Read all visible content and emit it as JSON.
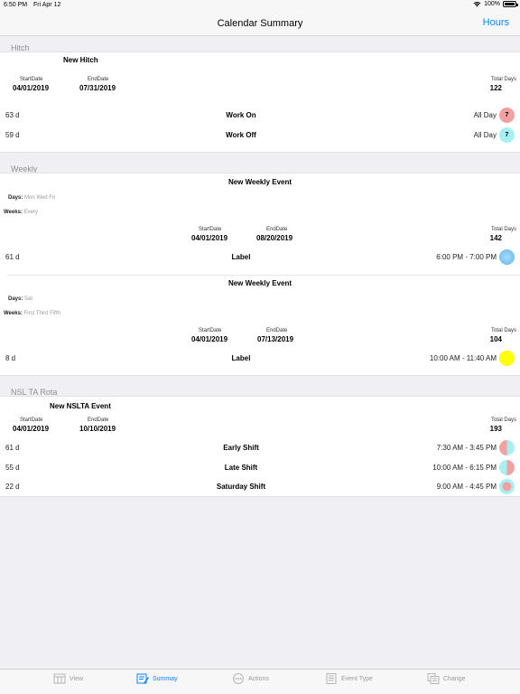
{
  "status": {
    "time": "6:50 PM",
    "date": "Fri Apr 12",
    "battery": "100%"
  },
  "navbar": {
    "title": "Calendar Summary",
    "right_button": "Hours"
  },
  "sections": {
    "hitch": {
      "header": "Hitch",
      "event": {
        "name": "New Hitch",
        "start_label": "StartDate",
        "start": "04/01/2019",
        "end_label": "EndDate",
        "end": "07/31/2019",
        "total_label": "Total Days",
        "total": "122",
        "rows": [
          {
            "count": "63 d",
            "label": "Work On",
            "time": "All Day",
            "badge": "7",
            "color": "#f4a0a0"
          },
          {
            "count": "59 d",
            "label": "Work Off",
            "time": "All Day",
            "badge": "7",
            "color": "#a6f0f2"
          }
        ]
      }
    },
    "weekly": {
      "header": "Weekly",
      "events": [
        {
          "name": "New Weekly Event",
          "days_label": "Days:",
          "days": "Mon Wed Fri",
          "weeks_label": "Weeks:",
          "weeks": "Every",
          "start_label": "StartDate",
          "start": "04/01/2019",
          "end_label": "EndDate",
          "end": "08/20/2019",
          "total_label": "Total Days",
          "total": "142",
          "row": {
            "count": "61 d",
            "label": "Label",
            "time": "6:00 PM - 7:00 PM",
            "color": "#7ec4f2"
          }
        },
        {
          "name": "New Weekly Event",
          "days_label": "Days:",
          "days": "Sat",
          "weeks_label": "Weeks:",
          "weeks": "First Third Fifth",
          "start_label": "StartDate",
          "start": "04/01/2019",
          "end_label": "EndDate",
          "end": "07/13/2019",
          "total_label": "Total Days",
          "total": "104",
          "row": {
            "count": "8 d",
            "label": "Label",
            "time": "10:00 AM - 11:40 AM",
            "color": "#ffff00"
          }
        }
      ]
    },
    "nsl": {
      "header": "NSL TA Rota",
      "event": {
        "name": "New NSLTA Event",
        "start_label": "StartDate",
        "start": "04/01/2019",
        "end_label": "EndDate",
        "end": "10/10/2019",
        "total_label": "Total Days",
        "total": "193",
        "rows": [
          {
            "count": "61 d",
            "label": "Early Shift",
            "time": "7:30 AM - 3:45 PM",
            "color_a": "#f4a0a0",
            "color_b": "#a6f0f2"
          },
          {
            "count": "55 d",
            "label": "Late Shift",
            "time": "10:00 AM - 6:15 PM",
            "color_a": "#a6f0f2",
            "color_b": "#f4a0a0"
          },
          {
            "count": "22 d",
            "label": "Saturday Shift",
            "time": "9:00 AM - 4:45 PM",
            "color_a": "#a6f0f2",
            "color_b": "#f4a0a0"
          }
        ]
      }
    }
  },
  "tabbar": {
    "tabs": [
      {
        "label": "View",
        "icon": "calendar-view-icon"
      },
      {
        "label": "Summay",
        "icon": "summary-edit-icon",
        "active": true
      },
      {
        "label": "Actions",
        "icon": "ellipsis-circle-icon"
      },
      {
        "label": "Event Type",
        "icon": "list-doc-icon"
      },
      {
        "label": "Change",
        "icon": "stacked-docs-icon"
      }
    ]
  }
}
